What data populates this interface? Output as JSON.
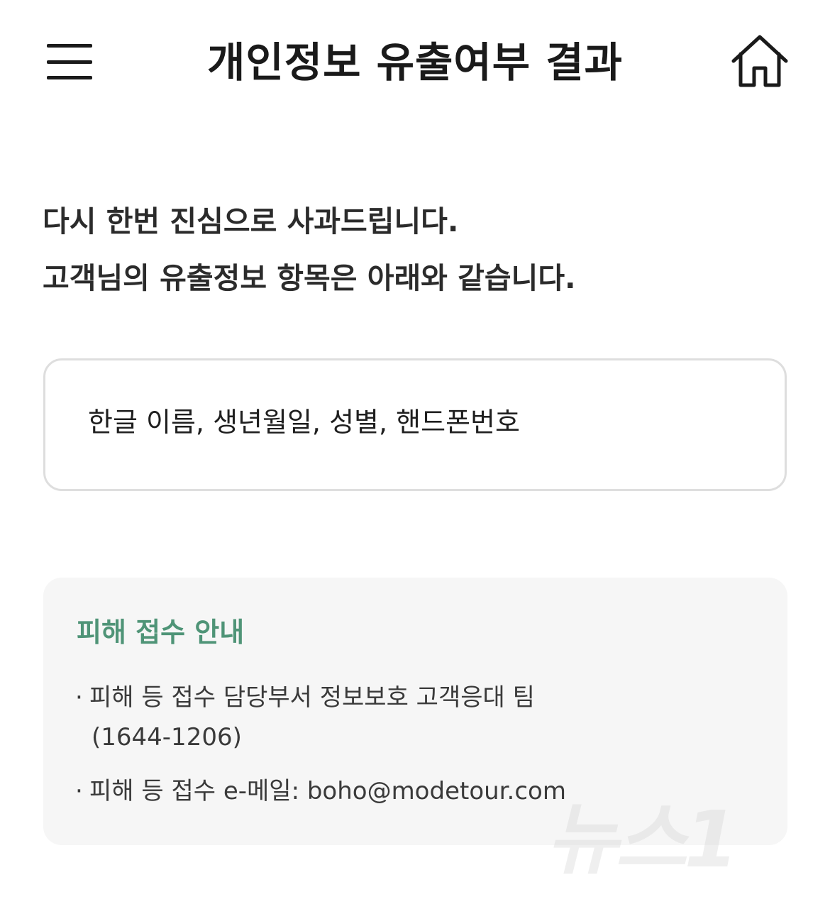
{
  "header": {
    "menu_icon": "hamburger-menu-icon",
    "title": "개인정보 유출여부 결과",
    "home_icon": "home-icon"
  },
  "apology": {
    "line1": "다시 한번 진심으로 사과드립니다.",
    "line2": "고객님의 유출정보 항목은 아래와 같습니다."
  },
  "leaked_items": {
    "text": "한글 이름, 생년월일, 성별, 핸드폰번호"
  },
  "notice": {
    "title": "피해 접수 안내",
    "bullet": "·",
    "line1": "피해 등 접수 담당부서 정보보호 고객응대 팀",
    "line1_phone": "(1644-1206)",
    "line2": "피해 등 접수 e-메일: boho@modetour.com"
  },
  "watermark": {
    "text": "뉴스1"
  },
  "colors": {
    "accent_green": "#4f9477",
    "box_border": "#dedede",
    "notice_bg": "#f6f6f6",
    "text_dark": "#1f1f1f"
  }
}
